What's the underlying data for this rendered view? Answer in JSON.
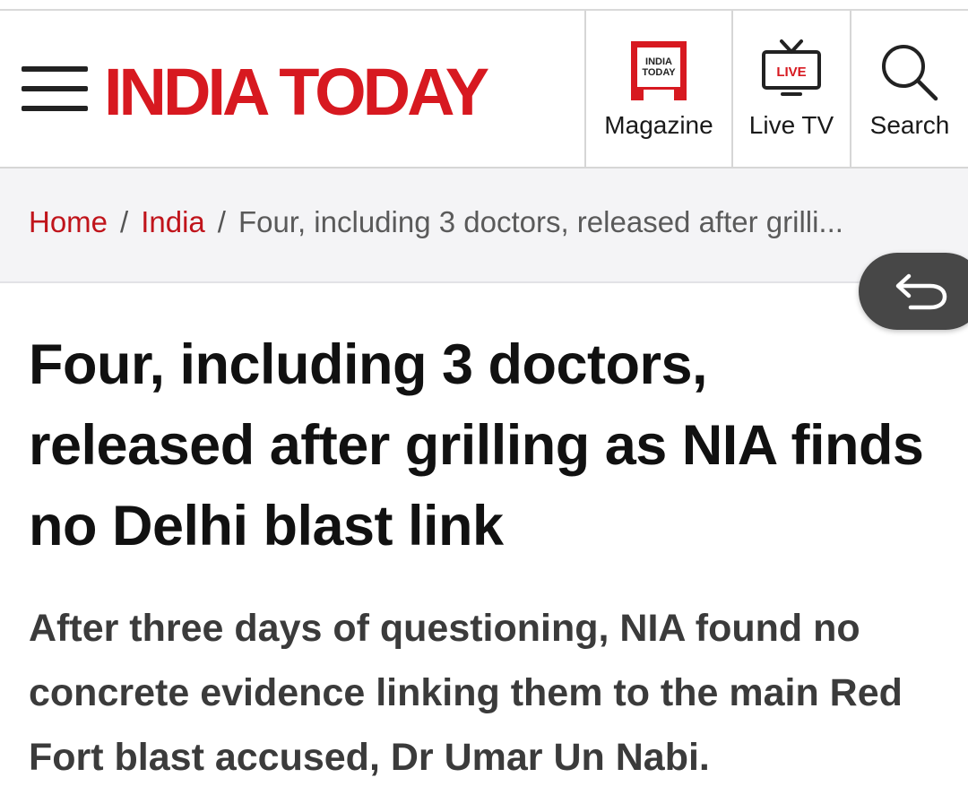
{
  "header": {
    "logo_text": "INDIA TODAY",
    "nav": [
      {
        "label": "Magazine",
        "icon": "magazine-icon",
        "icon_text_line1": "INDIA",
        "icon_text_line2": "TODAY"
      },
      {
        "label": "Live TV",
        "icon": "live-tv-icon",
        "icon_text": "LIVE"
      },
      {
        "label": "Search",
        "icon": "search-icon"
      }
    ]
  },
  "breadcrumb": {
    "items": [
      "Home",
      "India"
    ],
    "separator": "/",
    "current": "Four, including 3 doctors, released after grilli..."
  },
  "back_button": {
    "icon": "back-arrow-icon"
  },
  "article": {
    "headline": "Four, including 3 doctors, released after grilling as NIA finds no Delhi blast link",
    "summary": "After three days of questioning, NIA found no concrete evidence linking them to the main Red Fort blast accused, Dr Umar Un Nabi."
  },
  "colors": {
    "brand_red": "#d71920",
    "link_red": "#c0141b",
    "breadcrumb_bg": "#f4f4f6",
    "headline_text": "#111111",
    "summary_text": "#3b3b3b"
  }
}
